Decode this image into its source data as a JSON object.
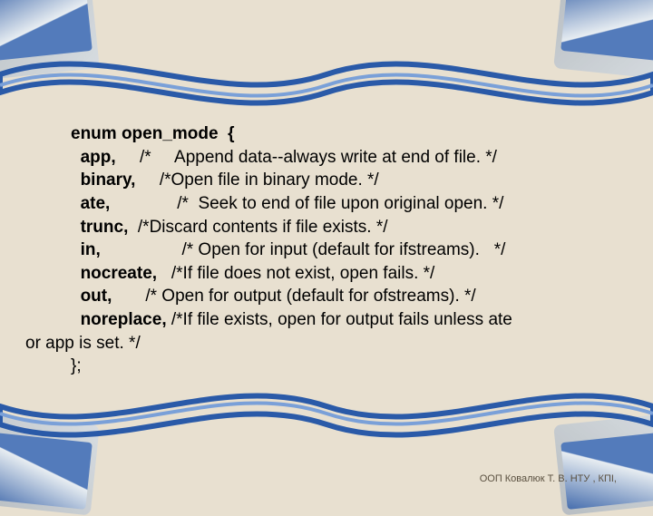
{
  "code": {
    "enum_decl_kw": "enum ",
    "enum_name": "open_mode  {",
    "lines": [
      {
        "kw": "app,",
        "cmt": "     /*     Append data--always write at end of file. */"
      },
      {
        "kw": "binary,",
        "cmt": "     /*Open file in binary mode. */"
      },
      {
        "kw": "ate,",
        "cmt": "              /*  Seek to end of file upon original open. */"
      },
      {
        "kw": "trunc,",
        "cmt": "  /*Discard contents if file exists. */"
      },
      {
        "kw": "in,",
        "cmt": "                 /* Open for input (default for ifstreams).   */"
      },
      {
        "kw": "nocreate,",
        "cmt": "   /*If file does not exist, open fails. */"
      },
      {
        "kw": "out,",
        "cmt": "       /* Open for output (default for ofstreams). */"
      },
      {
        "kw": "noreplace,",
        "cmt": " /*If file exists, open for output fails unless ate"
      }
    ],
    "tail_line": "or app is set. */",
    "close": "};"
  },
  "footer": "ООП Ковалюк Т. В. НТУ , КПІ,"
}
